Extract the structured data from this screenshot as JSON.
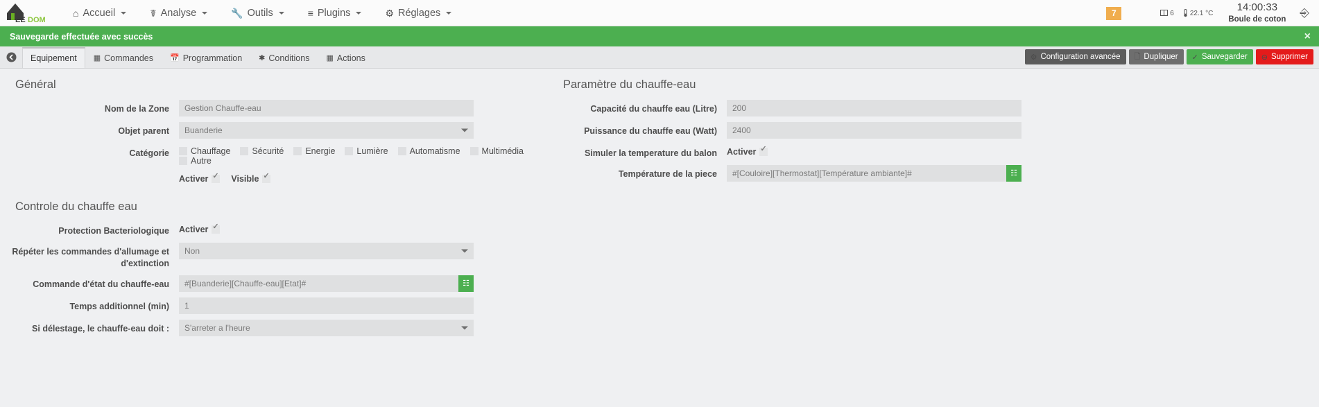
{
  "navbar": {
    "brand": "JEEDOM",
    "items": [
      {
        "label": "Accueil",
        "icon": "home-icon"
      },
      {
        "label": "Analyse",
        "icon": "stethoscope-icon"
      },
      {
        "label": "Outils",
        "icon": "wrench-icon"
      },
      {
        "label": "Plugins",
        "icon": "list-icon"
      },
      {
        "label": "Réglages",
        "icon": "gear-icon"
      }
    ],
    "badge_count": "7",
    "stats": [
      {
        "icon": "window-icon",
        "value": "6"
      },
      {
        "icon": "thermometer-icon",
        "value": "22.1 °C"
      }
    ],
    "clock_time": "14:00:33",
    "clock_label": "Boule de coton",
    "help_icon": "question-circle-icon"
  },
  "alert": {
    "message": "Sauvegarde effectuée avec succès",
    "close_label": "×",
    "color": "#4caf50"
  },
  "tabbar": {
    "back_icon": "arrow-left-circle-icon",
    "tabs": [
      {
        "label": "Equipement",
        "icon": "",
        "active": true
      },
      {
        "label": "Commandes",
        "icon": "table-icon",
        "active": false
      },
      {
        "label": "Programmation",
        "icon": "calendar-icon",
        "active": false
      },
      {
        "label": "Conditions",
        "icon": "asterisk-icon",
        "active": false
      },
      {
        "label": "Actions",
        "icon": "table-icon",
        "active": false
      }
    ],
    "actions": [
      {
        "label": "Configuration avancée",
        "icon": "cogs-icon",
        "style": "dark"
      },
      {
        "label": "Dupliquer",
        "icon": "copy-icon",
        "style": "grey"
      },
      {
        "label": "Sauvegarder",
        "icon": "check-circle-icon",
        "style": "green"
      },
      {
        "label": "Supprimer",
        "icon": "minus-circle-icon",
        "style": "red"
      }
    ]
  },
  "general": {
    "legend": "Général",
    "zone_name_label": "Nom de la Zone",
    "zone_name_value": "Gestion Chauffe-eau",
    "parent_label": "Objet parent",
    "parent_value": "Buanderie",
    "category_label": "Catégorie",
    "categories": [
      {
        "label": "Chauffage",
        "checked": false
      },
      {
        "label": "Sécurité",
        "checked": false
      },
      {
        "label": "Energie",
        "checked": false
      },
      {
        "label": "Lumière",
        "checked": false
      },
      {
        "label": "Automatisme",
        "checked": false
      },
      {
        "label": "Multimédia",
        "checked": false
      },
      {
        "label": "Autre",
        "checked": false
      }
    ],
    "activer_label": "Activer",
    "activer_checked": true,
    "visible_label": "Visible",
    "visible_checked": true
  },
  "parameters": {
    "legend": "Paramètre du chauffe-eau",
    "capacity_label": "Capacité du chauffe eau (Litre)",
    "capacity_value": "200",
    "power_label": "Puissance du chauffe eau (Watt)",
    "power_value": "2400",
    "simulate_label": "Simuler la temperature du balon",
    "simulate_activer_label": "Activer",
    "simulate_checked": true,
    "room_temp_label": "Température de la piece",
    "room_temp_value": "#[Couloire][Thermostat][Température ambiante]#",
    "room_temp_picker_icon": "list-alt-icon"
  },
  "control": {
    "legend": "Controle du chauffe eau",
    "bacterio_label": "Protection Bacteriologique",
    "bacterio_activer_label": "Activer",
    "bacterio_checked": true,
    "repeat_label": "Répéter les commandes d'allumage et d'extinction",
    "repeat_value": "Non",
    "state_cmd_label": "Commande d'état du chauffe-eau",
    "state_cmd_value": "#[Buanderie][Chauffe-eau][Etat]#",
    "state_cmd_picker_icon": "list-alt-icon",
    "extra_time_label": "Temps additionnel (min)",
    "extra_time_value": "1",
    "delestage_label": "Si délestage, le chauffe-eau doit :",
    "delestage_value": "S'arreter a l'heure"
  }
}
